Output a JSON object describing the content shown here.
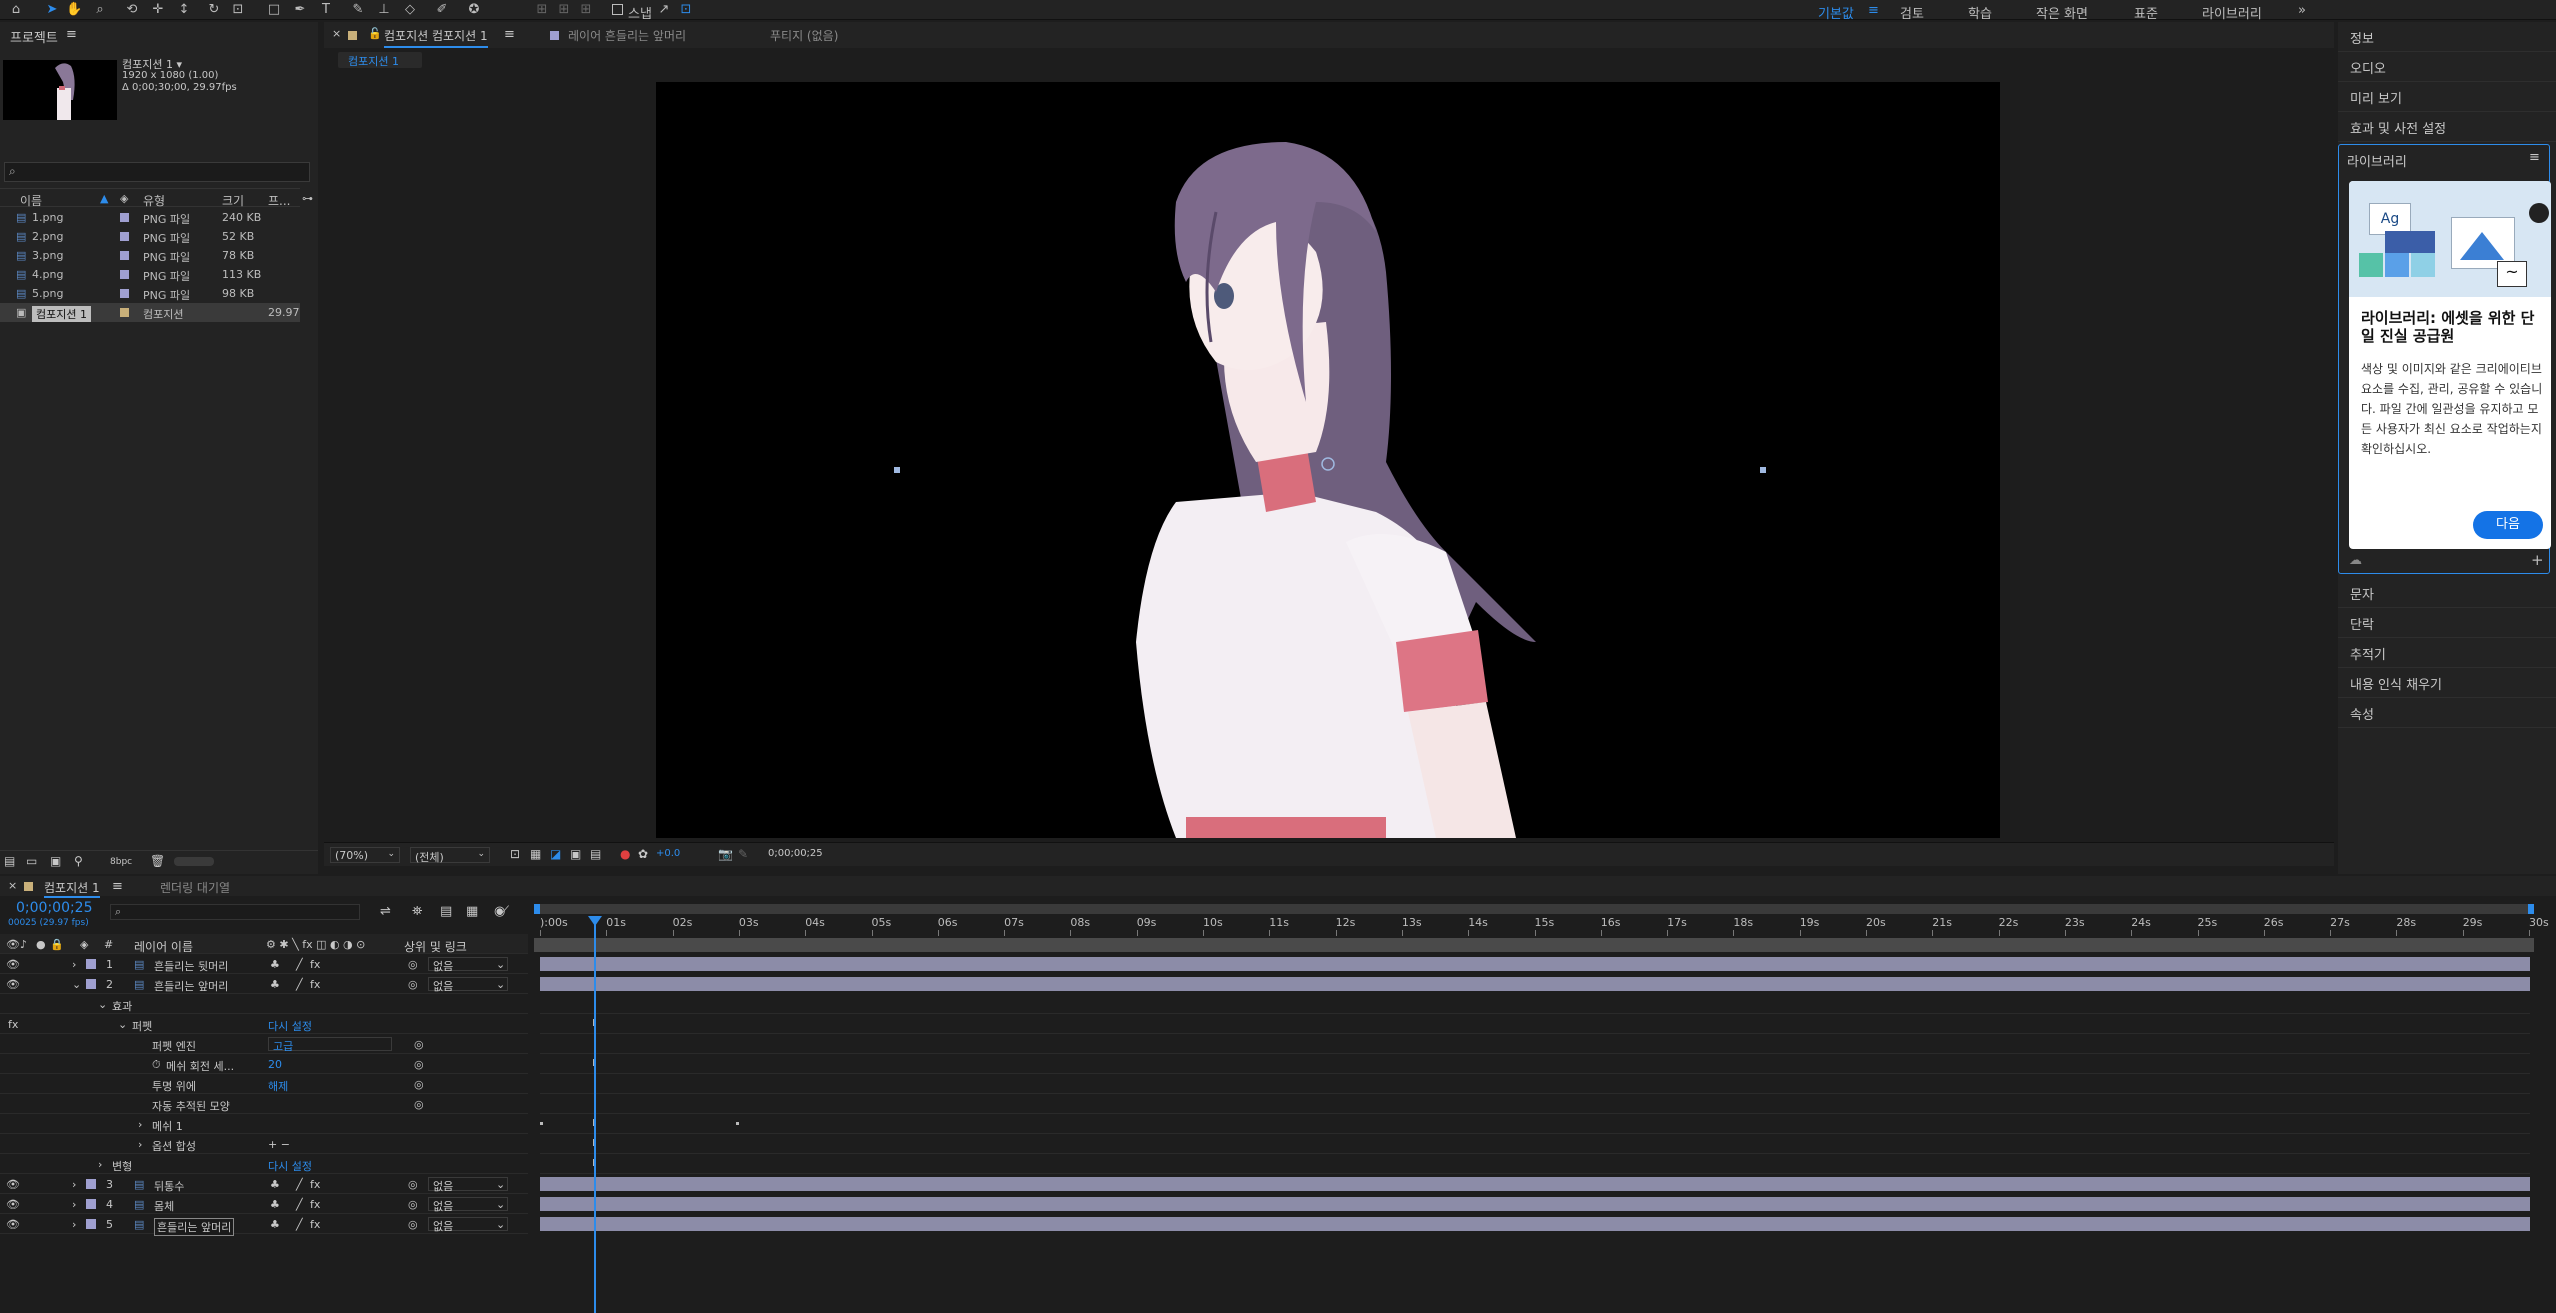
{
  "toolbar": {
    "snap_label": "스냅",
    "workspaces": [
      "기본값",
      "검토",
      "학습",
      "작은 화면",
      "표준",
      "라이브러리"
    ],
    "more": "»"
  },
  "project": {
    "title": "프로젝트",
    "comp_name": "컴포지션 1 ▾",
    "comp_dims": "1920 x 1080 (1.00)",
    "comp_duration": "Δ 0;00;30;00, 29.97fps",
    "search_placeholder": "",
    "columns": {
      "name": "이름",
      "type": "유형",
      "size": "크기",
      "fps": "프..."
    },
    "items": [
      {
        "name": "1.png",
        "type": "PNG 파일",
        "size": "240 KB",
        "fps": ""
      },
      {
        "name": "2.png",
        "type": "PNG 파일",
        "size": "52 KB",
        "fps": ""
      },
      {
        "name": "3.png",
        "type": "PNG 파일",
        "size": "78 KB",
        "fps": ""
      },
      {
        "name": "4.png",
        "type": "PNG 파일",
        "size": "113 KB",
        "fps": ""
      },
      {
        "name": "5.png",
        "type": "PNG 파일",
        "size": "98 KB",
        "fps": ""
      },
      {
        "name": "컴포지션 1",
        "type": "컴포지션",
        "size": "",
        "fps": "29.97"
      }
    ],
    "bpc": "8bpc"
  },
  "comp_viewer": {
    "tabs": [
      "컴포지션 컴포지션 1",
      "레이어 흔들리는 앞머리",
      "푸티지 (없음)"
    ],
    "breadcrumb": "컴포지션 1",
    "zoom": "(70%)",
    "resolution": "(전체)",
    "exposure": "+0.0",
    "timecode": "0;00;00;25"
  },
  "right_panel": {
    "items_top": [
      "정보",
      "오디오",
      "미리 보기",
      "효과 및 사전 설정"
    ],
    "library_title": "라이브러리",
    "library_heading": "라이브러리: 에셋을 위한 단일 진실 공급원",
    "library_body": "색상 및 이미지와 같은 크리에이티브 요소를 수집, 관리, 공유할 수 있습니다. 파일 간에 일관성을 유지하고 모든 사용자가 최신 요소로 작업하는지 확인하십시오.",
    "next_button": "다음",
    "ag_label": "Ag",
    "items_bottom": [
      "문자",
      "단락",
      "추적기",
      "내용 인식 채우기",
      "속성"
    ]
  },
  "timeline": {
    "tabs": [
      "컴포지션 1",
      "렌더링 대기열"
    ],
    "current_time": "0;00;00;25",
    "frame_info": "00025 (29.97 fps)",
    "columns": {
      "num": "#",
      "layer_name": "레이어 이름",
      "parent": "상위 및 링크"
    },
    "ruler": [
      "):00s",
      "01s",
      "02s",
      "03s",
      "04s",
      "05s",
      "06s",
      "07s",
      "08s",
      "09s",
      "10s",
      "11s",
      "12s",
      "13s",
      "14s",
      "15s",
      "16s",
      "17s",
      "18s",
      "19s",
      "20s",
      "21s",
      "22s",
      "23s",
      "24s",
      "25s",
      "26s",
      "27s",
      "28s",
      "29s",
      "30s"
    ],
    "layers_top": [
      {
        "num": "1",
        "name": "흔들리는 뒷머리",
        "parent": "없음"
      },
      {
        "num": "2",
        "name": "흔들리는 앞머리",
        "parent": "없음"
      }
    ],
    "props": {
      "effect": "효과",
      "puppet": "퍼펫",
      "reset": "다시 설정",
      "engine_label": "퍼펫 엔진",
      "engine_value": "고급",
      "mesh_rot_label": "메쉬 회전 세...",
      "mesh_rot_value": "20",
      "overlap_label": "투명 위에",
      "overlap_value": "해제",
      "auto_trace": "자동 추적된 모양",
      "mesh1": "메쉬 1",
      "options": "옵션 합성",
      "transform": "변형",
      "fx": "fx",
      "plusminus": "+ −"
    },
    "layers_bottom": [
      {
        "num": "3",
        "name": "뒤통수",
        "parent": "없음"
      },
      {
        "num": "4",
        "name": "몸체",
        "parent": "없음"
      },
      {
        "num": "5",
        "name": "흔들리는 앞머리",
        "parent": "없음"
      }
    ]
  },
  "colors": {
    "accent": "#2d8ceb",
    "layer_label": "#9f9fd0",
    "bar": "#8c8ca8"
  }
}
